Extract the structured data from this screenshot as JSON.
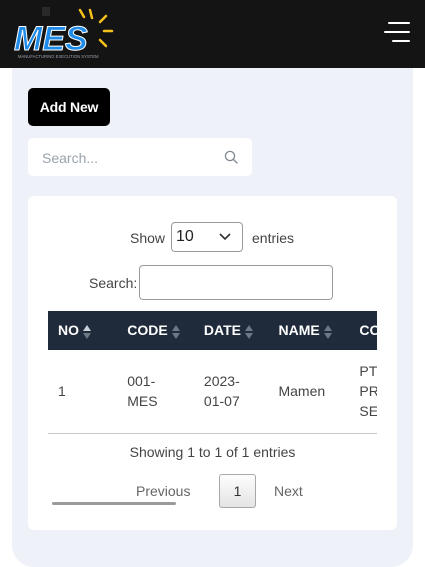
{
  "header": {
    "logo_text": "MES",
    "logo_tagline": "Manufacturing Execution System",
    "menu_icon": "hamburger-menu-icon"
  },
  "toolbar": {
    "add_new_label": "Add New",
    "search_placeholder": "Search..."
  },
  "datatable": {
    "show_label": "Show",
    "page_length": "10",
    "entries_label": "entries",
    "search_label": "Search:",
    "search_value": "",
    "columns": [
      "NO",
      "CODE",
      "DATE",
      "NAME",
      "COMPANY"
    ],
    "rows": [
      {
        "no": "1",
        "code": "001-MES",
        "date": "2023-01-07",
        "name": "Mamen",
        "company": "PT. BANTU PRIMA SEMESTA"
      }
    ],
    "info": "Showing 1 to 1 of 1 entries",
    "pagination": {
      "previous": "Previous",
      "current_page": "1",
      "next": "Next"
    }
  },
  "colors": {
    "topbar": "#141414",
    "content_bg": "#eef2f8",
    "table_header": "#1f2b3b",
    "logo_blue": "#1e8be8",
    "logo_yellow": "#f6c21a"
  }
}
